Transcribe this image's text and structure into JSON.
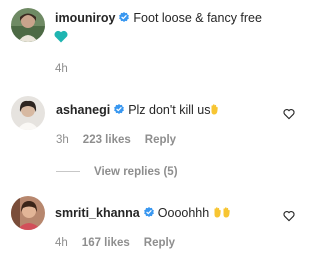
{
  "caption": {
    "username": "imouniroy",
    "text": "Foot loose & fancy free",
    "emoji_icon": "teal-heart-emoji",
    "time": "4h"
  },
  "comments": [
    {
      "username": "ashanegi",
      "text": "Plz don't kill us",
      "emoji_icon": "raised-hand-emoji",
      "time": "3h",
      "likes": "223 likes",
      "reply": "Reply"
    },
    {
      "username": "smriti_khanna",
      "text": "Oooohhh",
      "emoji_icon": "raised-hands-emoji",
      "time": "4h",
      "likes": "167 likes",
      "reply": "Reply"
    }
  ],
  "view_replies": "View replies (5)",
  "colors": {
    "text": "#262626",
    "muted": "#8e8e8e",
    "verified_blue": "#3897f0",
    "heart_teal": "#1fb5b1",
    "emoji_yellow": "#f7c532"
  }
}
